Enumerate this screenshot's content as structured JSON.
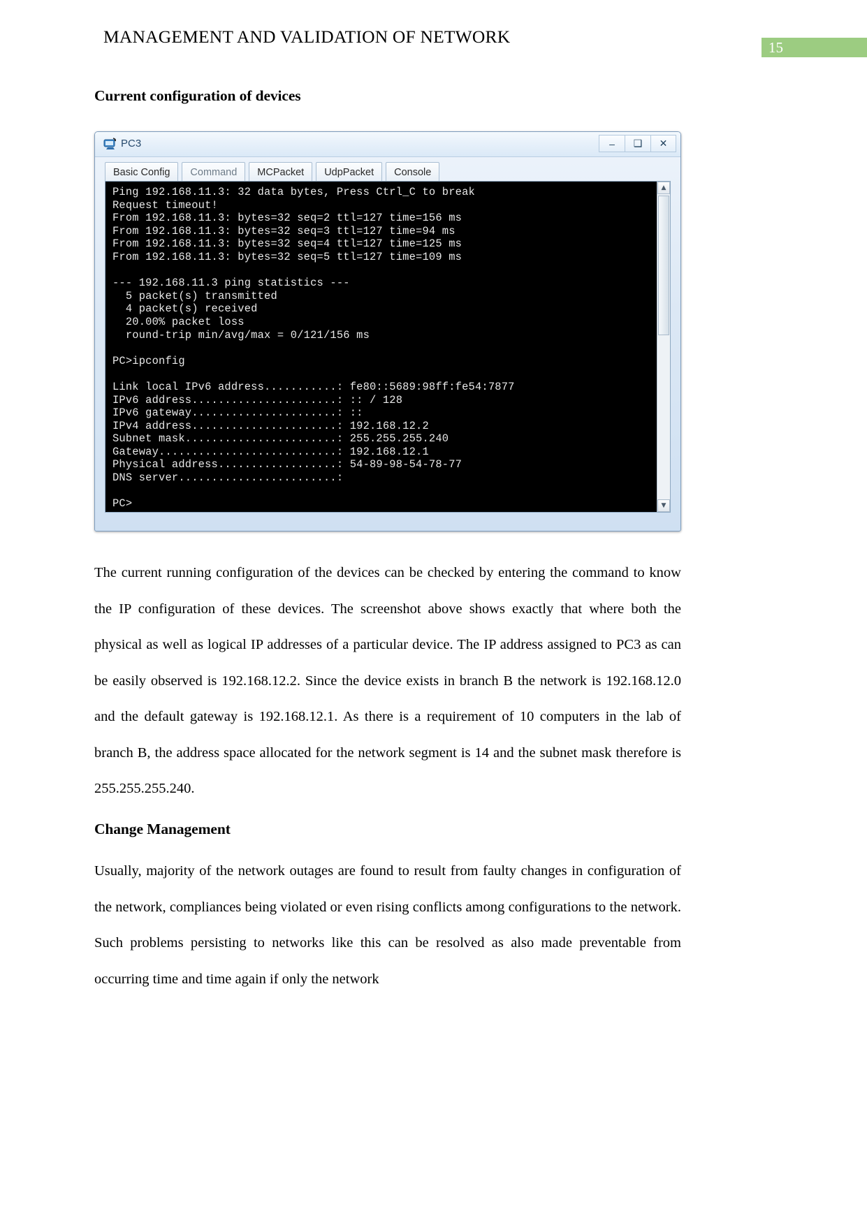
{
  "header": {
    "title": "MANAGEMENT AND VALIDATION OF NETWORK",
    "page_number": "15",
    "badge_color": "#9ccc81"
  },
  "sections": {
    "heading_1": "Current configuration of devices",
    "paragraph_1": "The current running configuration of the devices can be checked by entering the command to know the IP configuration of these devices. The screenshot above shows exactly that where both the physical as well as logical IP addresses of a particular device. The IP address assigned to PC3 as can be easily observed is 192.168.12.2. Since the device exists in branch B the network is 192.168.12.0 and the default gateway is 192.168.12.1. As there is a requirement of 10 computers in the lab of branch B, the address space allocated for the network segment is 14 and the subnet mask therefore is 255.255.255.240.",
    "heading_2": "Change Management",
    "paragraph_2": "Usually, majority of the network outages are found to result from faulty changes in configuration of the network, compliances being violated or even rising conflicts among configurations to the network. Such problems persisting to networks like this can be resolved as also made preventable from occurring time and time again if only the network"
  },
  "window": {
    "title": "PC3",
    "buttons": {
      "minimize": "–",
      "maximize": "❑",
      "close": "✕"
    },
    "tabs": [
      {
        "label": "Basic Config",
        "active": true
      },
      {
        "label": "Command",
        "active": false
      },
      {
        "label": "MCPacket",
        "active": true
      },
      {
        "label": "UdpPacket",
        "active": true
      },
      {
        "label": "Console",
        "active": true
      }
    ],
    "scrollbar": {
      "up_arrow": "▲",
      "down_arrow": "▼"
    },
    "terminal_lines": [
      "Ping 192.168.11.3: 32 data bytes, Press Ctrl_C to break",
      "Request timeout!",
      "From 192.168.11.3: bytes=32 seq=2 ttl=127 time=156 ms",
      "From 192.168.11.3: bytes=32 seq=3 ttl=127 time=94 ms",
      "From 192.168.11.3: bytes=32 seq=4 ttl=127 time=125 ms",
      "From 192.168.11.3: bytes=32 seq=5 ttl=127 time=109 ms",
      "",
      "--- 192.168.11.3 ping statistics ---",
      "  5 packet(s) transmitted",
      "  4 packet(s) received",
      "  20.00% packet loss",
      "  round-trip min/avg/max = 0/121/156 ms",
      "",
      "PC>ipconfig",
      "",
      "Link local IPv6 address...........: fe80::5689:98ff:fe54:7877",
      "IPv6 address......................: :: / 128",
      "IPv6 gateway......................: ::",
      "IPv4 address......................: 192.168.12.2",
      "Subnet mask.......................: 255.255.255.240",
      "Gateway...........................: 192.168.12.1",
      "Physical address..................: 54-89-98-54-78-77",
      "DNS server........................:",
      "",
      "PC>"
    ]
  }
}
